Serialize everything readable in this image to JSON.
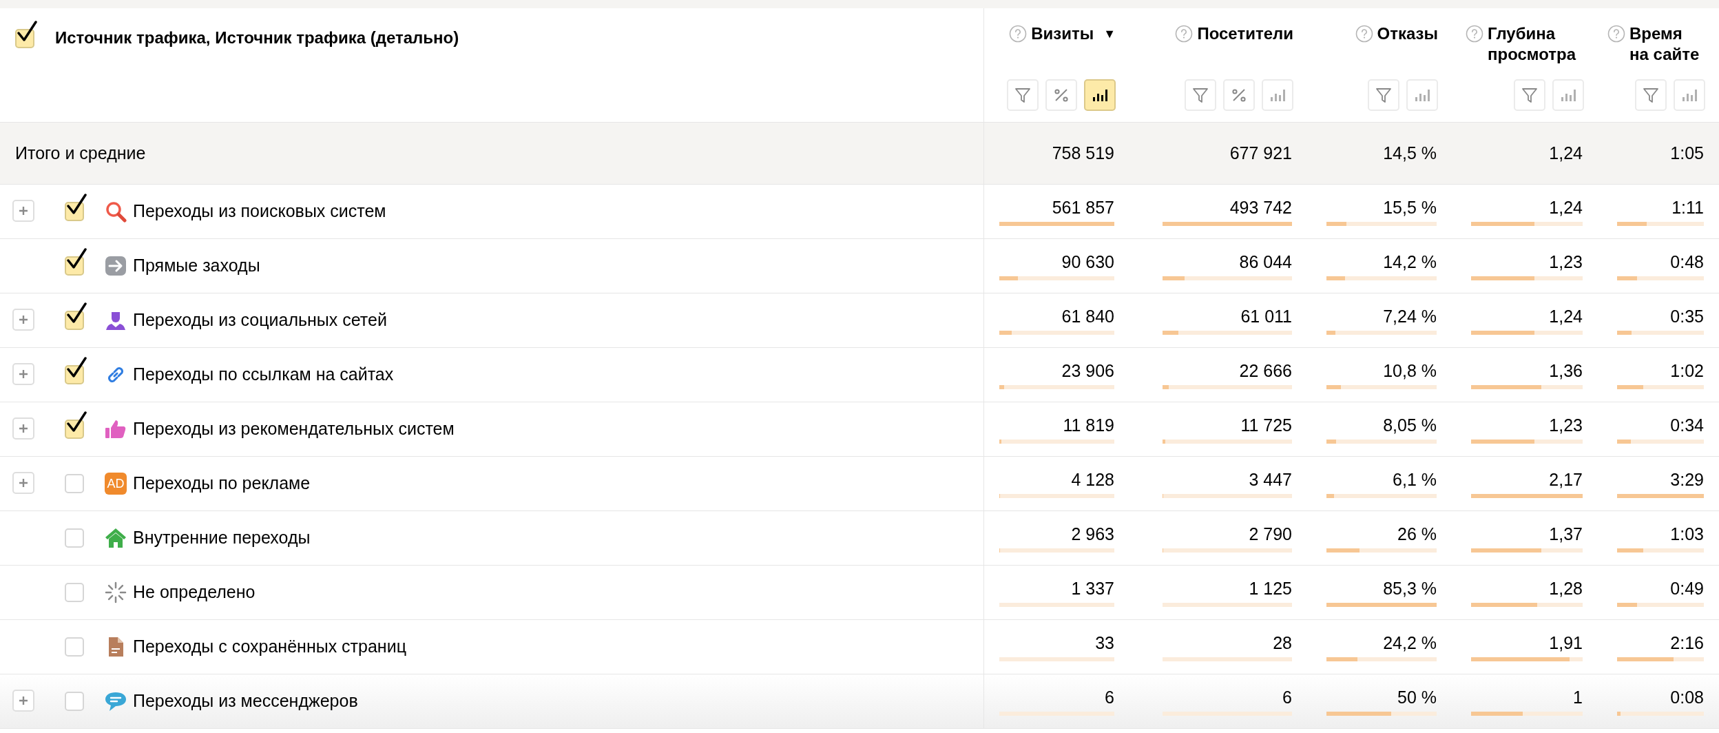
{
  "header": {
    "checked": true,
    "title": "Источник трафика, Источник трафика (детально)"
  },
  "metrics": [
    {
      "title": "Визиты",
      "sort_indicator": "▼",
      "buttons": [
        {
          "kind": "filter",
          "selected": false
        },
        {
          "kind": "percent",
          "selected": false
        },
        {
          "kind": "bars",
          "selected": true
        }
      ]
    },
    {
      "title": "Посетители",
      "buttons": [
        {
          "kind": "filter",
          "selected": false
        },
        {
          "kind": "percent",
          "selected": false
        },
        {
          "kind": "bars",
          "selected": false
        }
      ]
    },
    {
      "title": "Отказы",
      "buttons": [
        {
          "kind": "filter",
          "selected": false
        },
        {
          "kind": "bars",
          "selected": false
        }
      ]
    },
    {
      "title": "Глубина просмотра",
      "buttons": [
        {
          "kind": "filter",
          "selected": false
        },
        {
          "kind": "bars",
          "selected": false
        }
      ]
    },
    {
      "title": "Время на сайте",
      "buttons": [
        {
          "kind": "filter",
          "selected": false
        },
        {
          "kind": "bars",
          "selected": false
        }
      ]
    }
  ],
  "totals": {
    "label": "Итого и средние",
    "values": [
      "758 519",
      "677 921",
      "14,5 %",
      "1,24",
      "1:05"
    ]
  },
  "rows": [
    {
      "expandable": true,
      "checked": true,
      "kind": "search",
      "label": "Переходы из поисковых систем",
      "cells": [
        {
          "value": "561 857",
          "level": 1
        },
        {
          "value": "493 742",
          "level": 1
        },
        {
          "value": "15,5 %",
          "level": 0.18
        },
        {
          "value": "1,24",
          "level": 0.57
        },
        {
          "value": "1:11",
          "level": 0.34
        }
      ]
    },
    {
      "expandable": false,
      "checked": true,
      "kind": "direct",
      "label": "Прямые заходы",
      "cells": [
        {
          "value": "90 630",
          "level": 0.16
        },
        {
          "value": "86 044",
          "level": 0.17
        },
        {
          "value": "14,2 %",
          "level": 0.17
        },
        {
          "value": "1,23",
          "level": 0.57
        },
        {
          "value": "0:48",
          "level": 0.23
        }
      ]
    },
    {
      "expandable": true,
      "checked": true,
      "kind": "social",
      "label": "Переходы из социальных сетей",
      "cells": [
        {
          "value": "61 840",
          "level": 0.11
        },
        {
          "value": "61 011",
          "level": 0.12
        },
        {
          "value": "7,24 %",
          "level": 0.08
        },
        {
          "value": "1,24",
          "level": 0.57
        },
        {
          "value": "0:35",
          "level": 0.17
        }
      ]
    },
    {
      "expandable": true,
      "checked": true,
      "kind": "link",
      "label": "Переходы по ссылкам на сайтах",
      "cells": [
        {
          "value": "23 906",
          "level": 0.04
        },
        {
          "value": "22 666",
          "level": 0.05
        },
        {
          "value": "10,8 %",
          "level": 0.13
        },
        {
          "value": "1,36",
          "level": 0.63
        },
        {
          "value": "1:02",
          "level": 0.3
        }
      ]
    },
    {
      "expandable": true,
      "checked": true,
      "kind": "recommend",
      "label": "Переходы из рекомендательных систем",
      "cells": [
        {
          "value": "11 819",
          "level": 0.02
        },
        {
          "value": "11 725",
          "level": 0.02
        },
        {
          "value": "8,05 %",
          "level": 0.09
        },
        {
          "value": "1,23",
          "level": 0.57
        },
        {
          "value": "0:34",
          "level": 0.16
        }
      ]
    },
    {
      "expandable": true,
      "checked": false,
      "kind": "ad",
      "badge": "AD",
      "label": "Переходы по рекламе",
      "cells": [
        {
          "value": "4 128",
          "level": 0.008
        },
        {
          "value": "3 447",
          "level": 0.007
        },
        {
          "value": "6,1 %",
          "level": 0.07
        },
        {
          "value": "2,17",
          "level": 1
        },
        {
          "value": "3:29",
          "level": 1
        }
      ]
    },
    {
      "expandable": false,
      "checked": false,
      "kind": "internal",
      "label": "Внутренние переходы",
      "cells": [
        {
          "value": "2 963",
          "level": 0.005
        },
        {
          "value": "2 790",
          "level": 0.006
        },
        {
          "value": "26 %",
          "level": 0.3
        },
        {
          "value": "1,37",
          "level": 0.63
        },
        {
          "value": "1:03",
          "level": 0.3
        }
      ]
    },
    {
      "expandable": false,
      "checked": false,
      "kind": "undefined",
      "label": "Не определено",
      "cells": [
        {
          "value": "1 337",
          "level": 0
        },
        {
          "value": "1 125",
          "level": 0
        },
        {
          "value": "85,3 %",
          "level": 1
        },
        {
          "value": "1,28",
          "level": 0.59
        },
        {
          "value": "0:49",
          "level": 0.23
        }
      ]
    },
    {
      "expandable": false,
      "checked": false,
      "kind": "saved",
      "label": "Переходы с сохранённых страниц",
      "cells": [
        {
          "value": "33",
          "level": 0
        },
        {
          "value": "28",
          "level": 0
        },
        {
          "value": "24,2 %",
          "level": 0.28
        },
        {
          "value": "1,91",
          "level": 0.88
        },
        {
          "value": "2:16",
          "level": 0.65
        }
      ]
    },
    {
      "expandable": true,
      "checked": false,
      "kind": "messenger",
      "label": "Переходы из мессенджеров",
      "cells": [
        {
          "value": "6",
          "level": 0
        },
        {
          "value": "6",
          "level": 0
        },
        {
          "value": "50 %",
          "level": 0.59
        },
        {
          "value": "1",
          "level": 0.46
        },
        {
          "value": "0:08",
          "level": 0.04
        }
      ]
    }
  ]
}
